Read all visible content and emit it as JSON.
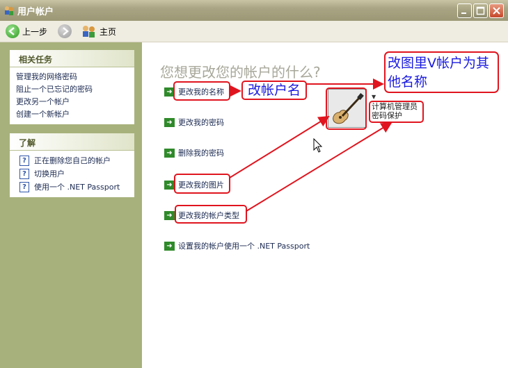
{
  "window": {
    "title": "用户帐户",
    "controls": [
      "minimize",
      "maximize",
      "close"
    ],
    "icons": {
      "app": "users-icon"
    }
  },
  "toolbar": {
    "back_label": "上一步",
    "home_label": "主页"
  },
  "sidebar": {
    "related_tasks": {
      "title": "相关任务",
      "items": [
        "管理我的网络密码",
        "阻止一个已忘记的密码",
        "更改另一个帐户",
        "创建一个新帐户"
      ]
    },
    "learn": {
      "title": "了解",
      "items": [
        "正在删除您自己的帐户",
        "切换用户",
        "使用一个 .NET Passport"
      ]
    }
  },
  "main": {
    "heading": "您想更改您的帐户的什么?",
    "actions": [
      "更改我的名称",
      "更改我的密码",
      "删除我的密码",
      "更改我的图片",
      "更改我的帐户类型",
      "设置我的帐户使用一个 .NET Passport"
    ],
    "user": {
      "type": "计算机管理员",
      "status": "密码保护",
      "picture": "guitar-picture"
    }
  },
  "annotations": {
    "rename": "改帐户名",
    "note_line1": "改图里V帐户为其",
    "note_line2": "他名称",
    "color": "#e0141e"
  },
  "colors": {
    "sidebar": "#a7b17c",
    "link": "#1b2a51",
    "heading": "#a8a79a",
    "annotation_text": "#1a1ae0"
  }
}
